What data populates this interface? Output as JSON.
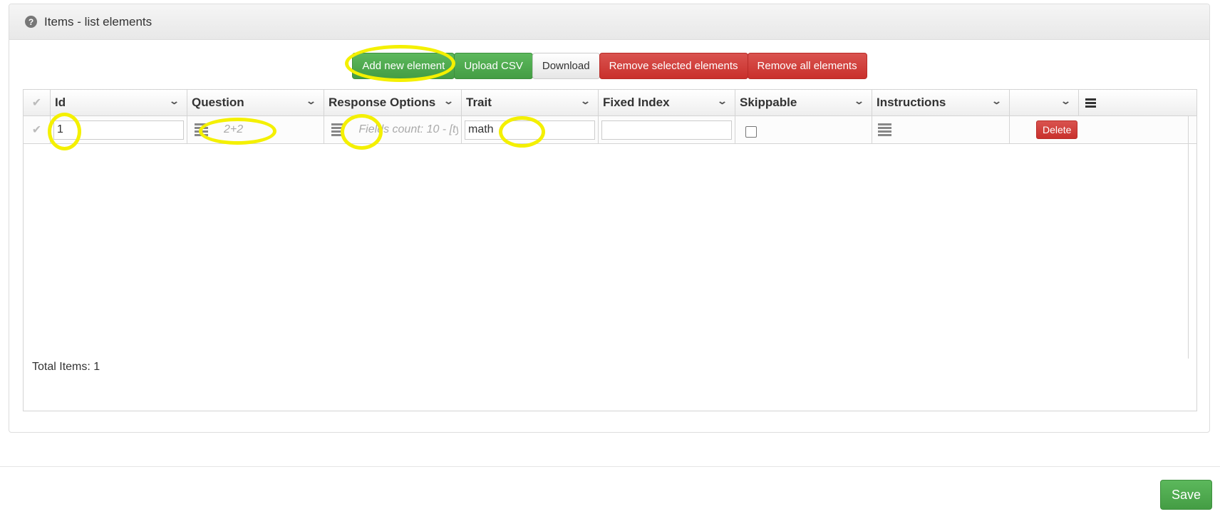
{
  "panel": {
    "help_icon": "?",
    "title": "Items - list elements"
  },
  "toolbar": {
    "add_label": "Add new element",
    "upload_label": "Upload CSV",
    "download_label": "Download",
    "remove_selected_label": "Remove selected elements",
    "remove_all_label": "Remove all elements"
  },
  "grid": {
    "columns": [
      "Id",
      "Question",
      "Response Options",
      "Trait",
      "Fixed Index",
      "Skippable",
      "Instructions",
      ""
    ],
    "rows": [
      {
        "id": "1",
        "question": "2+2",
        "response_options": "Fields count: 10 - [ty",
        "trait": "math",
        "fixed_index": "",
        "skippable": false,
        "delete_label": "Delete"
      }
    ],
    "total_label": "Total Items: 1"
  },
  "footer": {
    "save_label": "Save"
  },
  "colors": {
    "success": "#449d44",
    "danger": "#c9302c",
    "highlight": "#f4f000"
  }
}
